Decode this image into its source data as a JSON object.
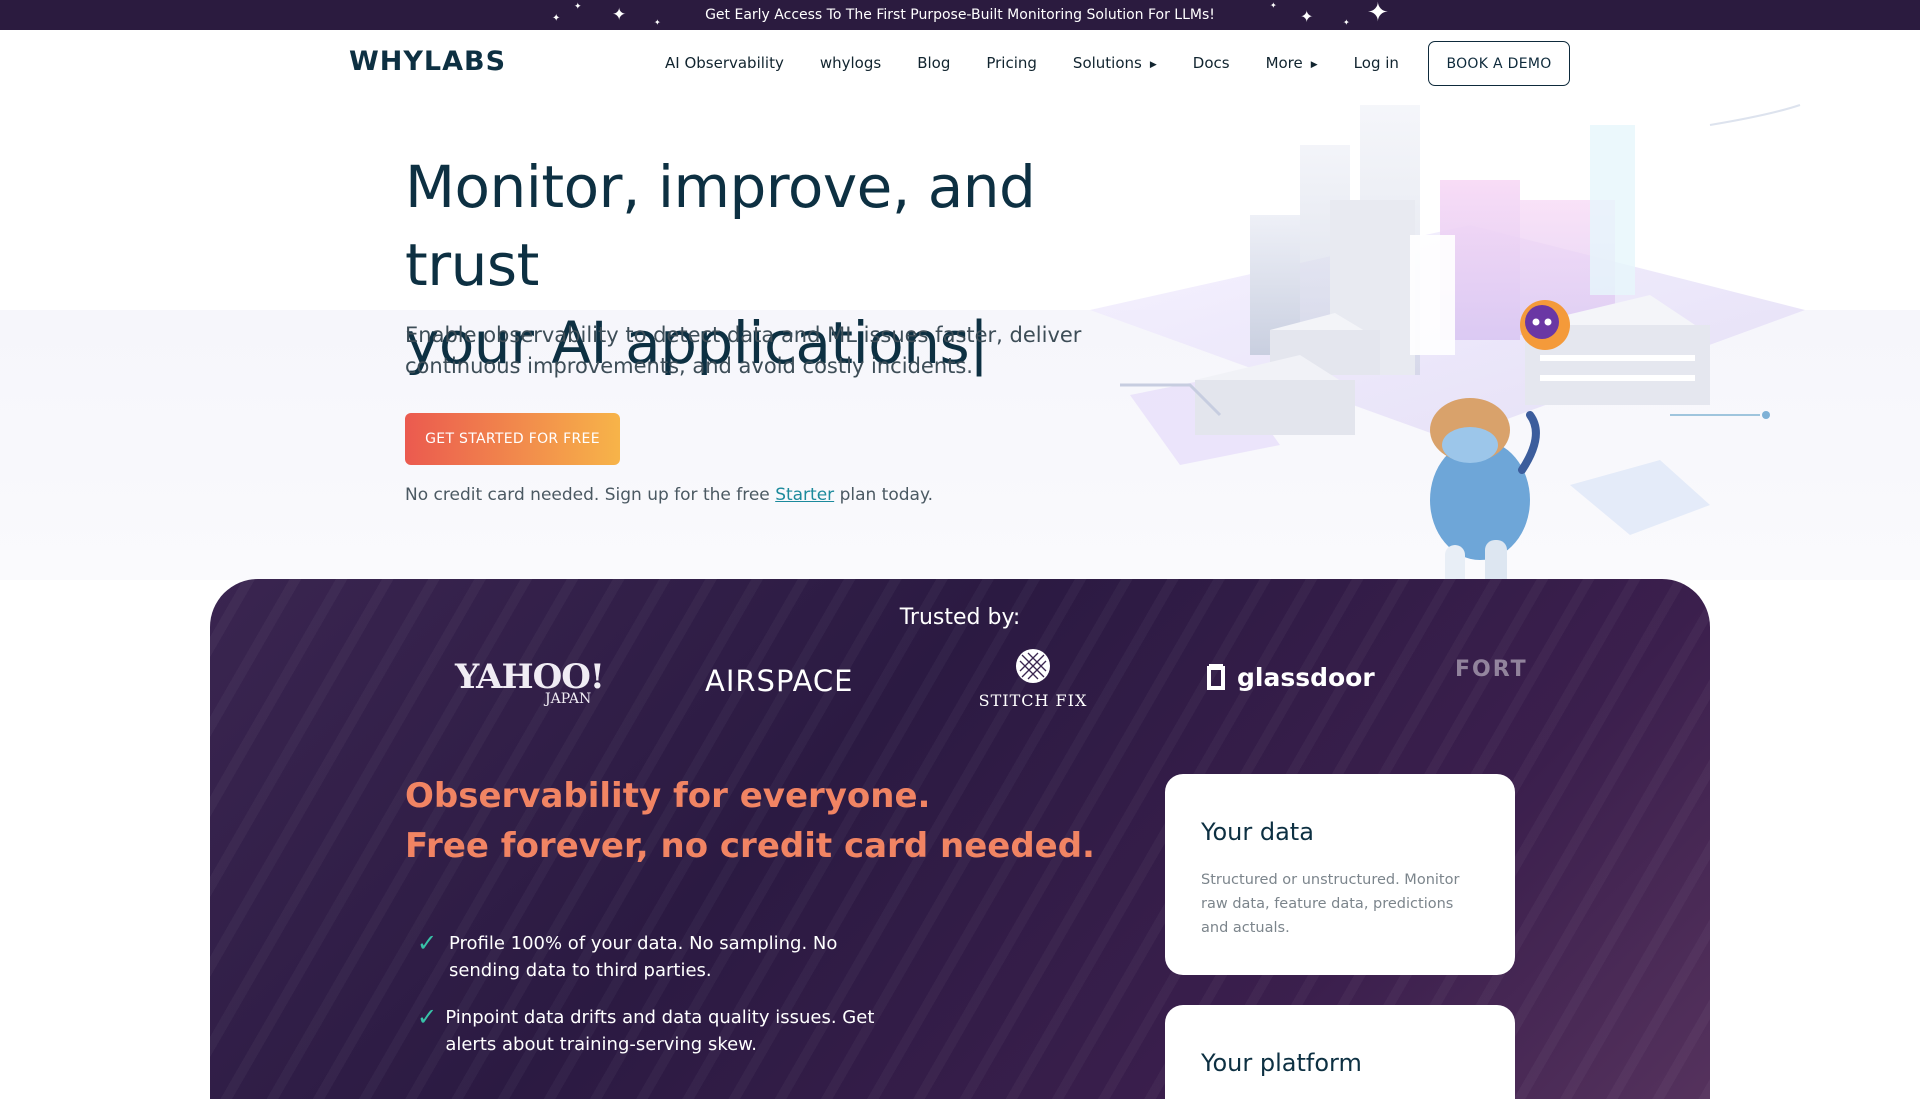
{
  "announcement": {
    "text": "Get Early Access To The First Purpose-Built Monitoring Solution For LLMs!"
  },
  "header": {
    "logo": "WHYLABS",
    "nav": [
      {
        "label": "AI Observability",
        "has_caret": false
      },
      {
        "label": "whylogs",
        "has_caret": false
      },
      {
        "label": "Blog",
        "has_caret": false
      },
      {
        "label": "Pricing",
        "has_caret": false
      },
      {
        "label": "Solutions",
        "has_caret": true
      },
      {
        "label": "Docs",
        "has_caret": false
      },
      {
        "label": "More",
        "has_caret": true
      },
      {
        "label": "Log in",
        "has_caret": false
      }
    ],
    "demo_button": "BOOK A DEMO"
  },
  "hero": {
    "title_line1": "Monitor, improve, and trust",
    "title_line2": "your AI applications|",
    "subtitle": "Enable observability to detect data and ML issues faster, deliver continuous improvements, and avoid costly incidents.",
    "cta": "GET STARTED FOR FREE",
    "note_prefix": "No credit card needed. Sign up for the free ",
    "note_link": "Starter",
    "note_suffix": " plan today."
  },
  "trusted": {
    "label": "Trusted by:",
    "logos": [
      "YAHOO!",
      "JAPAN",
      "AIRSPACE",
      "STITCH FIX",
      "glassdoor",
      "FORT"
    ]
  },
  "observability": {
    "title_line1": "Observability for everyone.",
    "title_line2": "Free forever, no credit card needed.",
    "features": [
      "Profile 100% of your data. No sampling. No sending data to third parties.",
      "Pinpoint data drifts and data quality issues. Get alerts about training-serving skew."
    ]
  },
  "cards": [
    {
      "title": "Your data",
      "text": "Structured or unstructured. Monitor raw data, feature data, predictions and actuals."
    },
    {
      "title": "Your platform",
      "text": ""
    }
  ],
  "colors": {
    "announcement_bg": "#2b1b3f",
    "cta_start": "#eb5a4f",
    "cta_end": "#f7b449",
    "accent_orange": "#f18463",
    "check": "#38c2a8",
    "link": "#1c8a9c"
  },
  "icons": {
    "dropdown": "caret-right-icon",
    "check": "checkmark-icon"
  }
}
